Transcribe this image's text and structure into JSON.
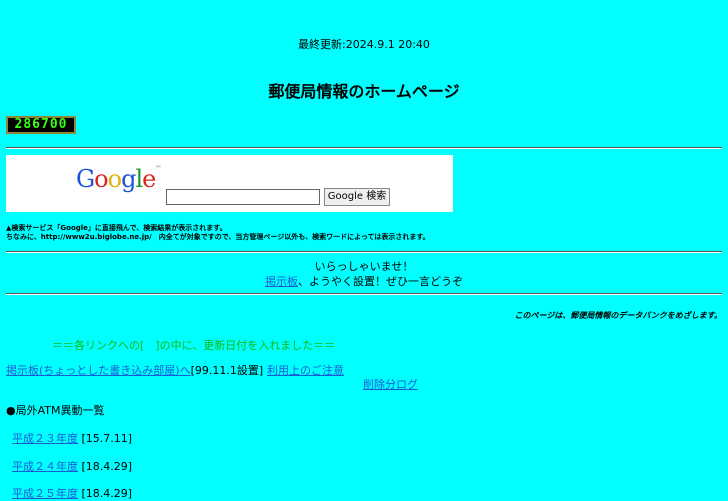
{
  "last_updated": "最終更新:2024.9.1 20:40",
  "page_title": "郵便局情報のホームページ",
  "counter_value": "286700",
  "search": {
    "logo_text": "Google",
    "button_label": "Google 検索",
    "input_value": ""
  },
  "search_note": [
    "▲検索サービス「Google」に直接飛んで、検索結果が表示されます。",
    "ちなみに、http://www2u.biglobe.ne.jp/　内全てが対象ですので、当方管理ページ以外も、検索ワードによっては表示されます。"
  ],
  "welcome": {
    "line1": "いらっしゃいませ！",
    "bbs_link": "掲示板",
    "line2_rest": "、ようやく設置！ぜひ一言どうぞ"
  },
  "tagline": "このページは、郵便局情報のデータバンクをめざします。",
  "update_notice": "＝＝各リンクへの[　]の中に、更新日付を入れました＝＝",
  "links": {
    "bbs_room": "掲示板(ちょっとした書き込み部屋)へ",
    "bbs_room_date": "[99.11.1設置]",
    "usage_notes": "利用上のご注意",
    "deleted_log": "削除分ログ"
  },
  "atm_section_title": "●局外ATM異動一覧",
  "atm_items": [
    {
      "label": "平成２３年度",
      "date": "[15.7.11]"
    },
    {
      "label": "平成２４年度",
      "date": "[18.4.29]"
    },
    {
      "label": "平成２５年度",
      "date": "[18.4.29]"
    }
  ],
  "colors": {
    "background": "#00ffff",
    "link": "#1a5bd6",
    "notice_green": "#11b611"
  }
}
